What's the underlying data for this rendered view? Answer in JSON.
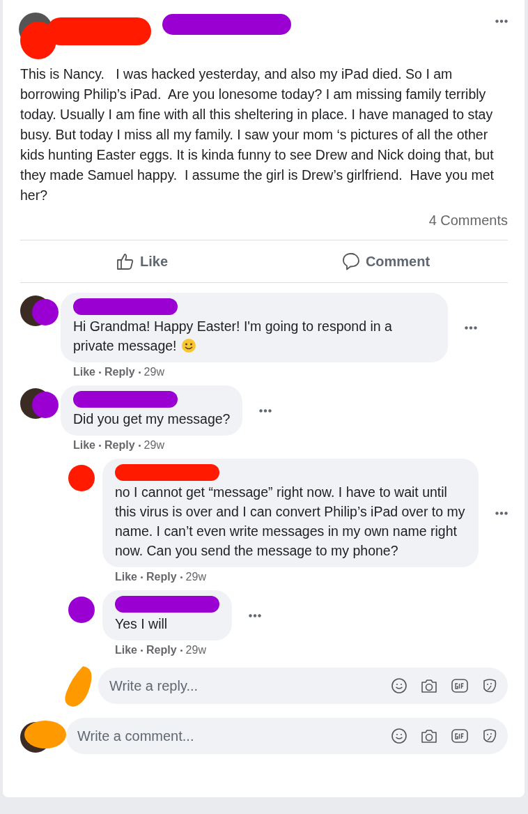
{
  "post": {
    "redactions": [
      {
        "color": "#ff1a00"
      },
      {
        "color": "#ff1a00"
      },
      {
        "color": "#9b00d3"
      }
    ],
    "text": "This is Nancy.   I was hacked yesterday, and also my iPad died. So I am borrowing Philip’s iPad.  Are you lonesome today? I am missing family terribly today. Usually I am fine with all this sheltering in place. I have managed to stay busy. But today I miss all my family. I saw your mom ‘s pictures of all the other kids hunting Easter eggs. It is kinda funny to see Drew and Nick doing that, but they made Samuel happy.  I assume the girl is Drew’s girlfriend.  Have you met her?",
    "comment_count": "4 Comments"
  },
  "actions": [
    {
      "kind": "like",
      "label": "Like"
    },
    {
      "kind": "comment",
      "label": "Comment"
    }
  ],
  "comments": [
    {
      "color": "#9b00d3",
      "text": "Hi Grandma! Happy Easter! I'm going to respond in a private message!",
      "emoji": true,
      "like": "Like",
      "reply": "Reply",
      "time": "29w"
    },
    {
      "color": "#9b00d3",
      "text": "Did you get my message?",
      "emoji": false,
      "like": "Like",
      "reply": "Reply",
      "time": "29w",
      "children": [
        {
          "color": "#ff1a00",
          "text": "no I cannot get “message” right now. I have to wait until this virus is over and I can convert Philip’s iPad over to my name. I can’t even write messages in my own name right now. Can you send the message to my phone?",
          "emoji": false,
          "like": "Like",
          "reply": "Reply",
          "time": "29w"
        },
        {
          "color": "#9b00d3",
          "text": "Yes I will",
          "emoji": false,
          "like": "Like",
          "reply": "Reply",
          "time": "29w"
        }
      ]
    }
  ],
  "reply_box": {
    "placeholder": "Write a reply..."
  },
  "comment_box": {
    "placeholder": "Write a comment..."
  }
}
